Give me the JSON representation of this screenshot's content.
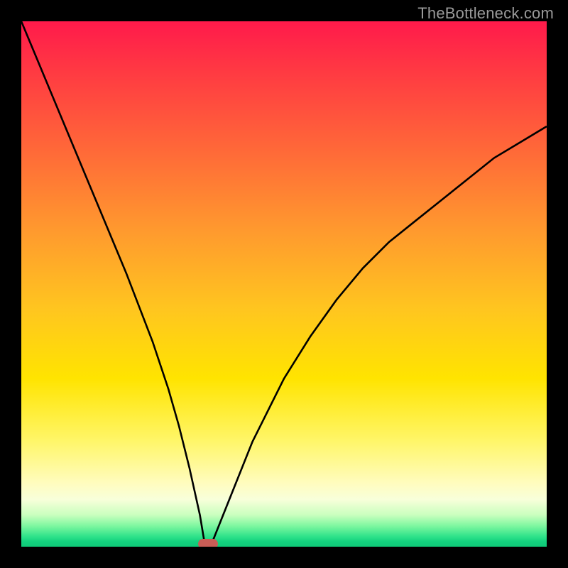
{
  "watermark": "TheBottleneck.com",
  "chart_data": {
    "type": "line",
    "title": "",
    "xlabel": "",
    "ylabel": "",
    "xlim": [
      0,
      100
    ],
    "ylim": [
      0,
      100
    ],
    "x": [
      0,
      5,
      10,
      15,
      20,
      25,
      28,
      30,
      32,
      34,
      35,
      36,
      38,
      40,
      42,
      44,
      46,
      50,
      55,
      60,
      65,
      70,
      75,
      80,
      85,
      90,
      95,
      100
    ],
    "values": [
      100,
      88,
      76,
      64,
      52,
      39,
      30,
      23,
      15,
      6,
      0,
      0,
      5,
      10,
      15,
      20,
      24,
      32,
      40,
      47,
      53,
      58,
      62,
      66,
      70,
      74,
      77,
      80
    ],
    "marker": {
      "x": 35.5,
      "y": 0
    },
    "background_gradient": {
      "stops": [
        {
          "pos": 0,
          "color": "#ff1a4b"
        },
        {
          "pos": 10,
          "color": "#ff3b42"
        },
        {
          "pos": 25,
          "color": "#ff6a38"
        },
        {
          "pos": 40,
          "color": "#ff9a2e"
        },
        {
          "pos": 55,
          "color": "#ffc61f"
        },
        {
          "pos": 68,
          "color": "#ffe400"
        },
        {
          "pos": 80,
          "color": "#fff66a"
        },
        {
          "pos": 88,
          "color": "#fffcbf"
        },
        {
          "pos": 91,
          "color": "#f8ffda"
        },
        {
          "pos": 94,
          "color": "#c9ffbe"
        },
        {
          "pos": 96,
          "color": "#7ff7a0"
        },
        {
          "pos": 98,
          "color": "#31e38b"
        },
        {
          "pos": 100,
          "color": "#0fc978"
        }
      ]
    }
  }
}
